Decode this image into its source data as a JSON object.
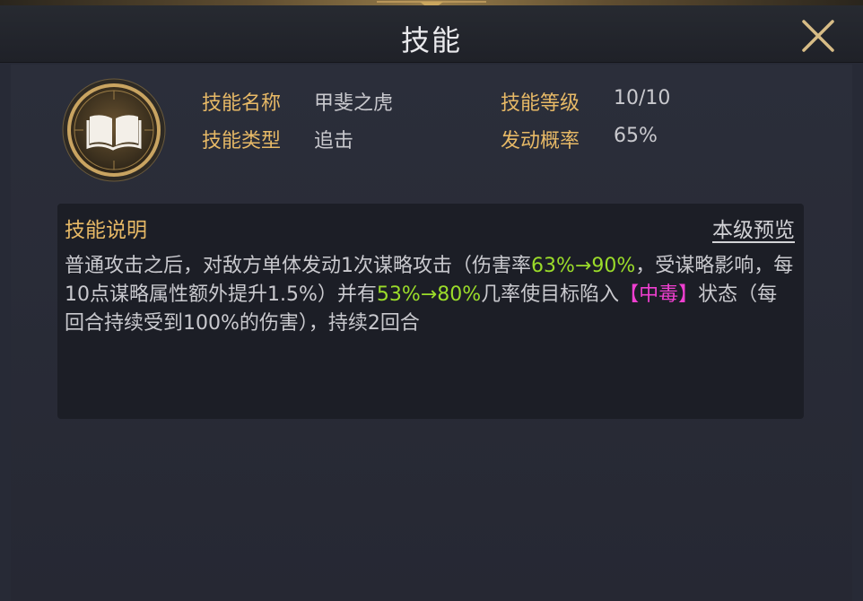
{
  "window": {
    "title": "技能"
  },
  "skill": {
    "name_label": "技能名称",
    "name_value": "甲斐之虎",
    "type_label": "技能类型",
    "type_value": "追击",
    "level_label": "技能等级",
    "level_value": "10/10",
    "chance_label": "发动概率",
    "chance_value": "65%",
    "icon": "open-book-icon"
  },
  "description": {
    "title": "技能说明",
    "preview_link": "本级预览",
    "seg1": "普通攻击之后，对敌方单体发动1次谋略攻击（伤害率",
    "hl1": "63%→90%",
    "seg2": "，受谋略影响，每10点谋略属性额外提升1.5%）并有",
    "hl2": "53%→80%",
    "seg3": "几率使目标陷入",
    "status": "【中毒】",
    "seg4": "状态（每回合持续受到100%的伤害），持续2回合"
  },
  "colors": {
    "gold_label": "#e7b966",
    "value_text": "#c9c9ce",
    "highlight_green": "#9bdc2a",
    "highlight_pink": "#ef3fd0"
  }
}
